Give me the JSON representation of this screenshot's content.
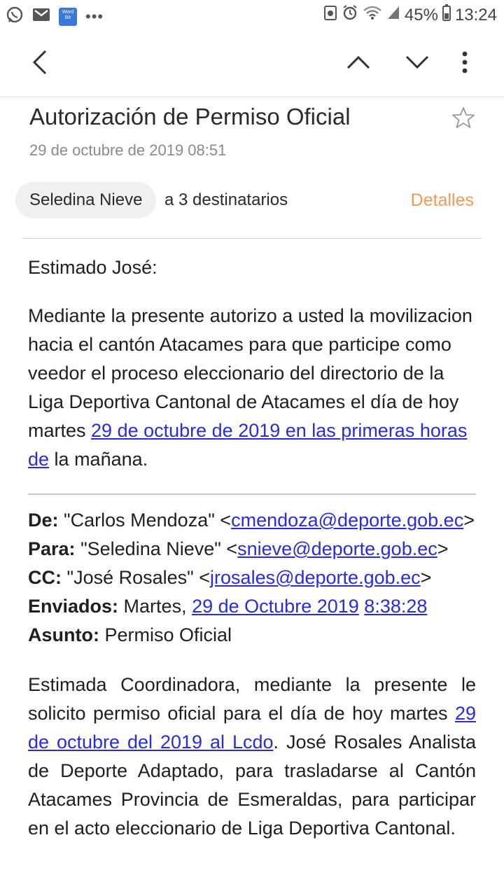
{
  "status": {
    "battery": "45%",
    "time": "13:24",
    "overflow": "•••"
  },
  "email": {
    "subject": "Autorización de Permiso Oficial",
    "date": "29 de octubre de 2019  08:51",
    "sender_chip": "Seledina Nieve",
    "recipients": "a 3 destinatarios",
    "details_label": "Detalles",
    "greeting": "Estimado José:",
    "p1_text": "Mediante la presente autorizo a usted la movilizacion hacia el cantón Atacames para que participe como veedor el proceso eleccionario del directorio de la Liga Deportiva Cantonal de Atacames el día de hoy martes ",
    "p1_link": "29 de octubre de 2019 en las primeras horas de",
    "p1_tail": " la mañana.",
    "fwd": {
      "from_label": "De:",
      "from_name": "\"Carlos Mendoza\"",
      "from_email": "cmendoza@deporte.gob.ec",
      "to_label": "Para:",
      "to_name": "\"Seledina Nieve\"",
      "to_email": "snieve@deporte.gob.ec",
      "cc_label": "CC:",
      "cc_name": "\"José Rosales\"",
      "cc_email": "jrosales@deporte.gob.ec",
      "sent_label": "Enviados:",
      "sent_day": "Martes,",
      "sent_date": "29 de Octubre 2019",
      "sent_time": "8:38:28",
      "subject_label": "Asunto:",
      "subject_value": "Permiso Oficial"
    },
    "p2_text": "Estimada Coordinadora, mediante la presente le solicito permiso oficial para el día de hoy martes ",
    "p2_link": "29 de octubre del 2019 al Lcdo",
    "p2_tail": ". José Rosales Analista de Deporte Adaptado, para trasladarse al Cantón Atacames Provincia de Esmeraldas, para participar en el acto eleccionario de Liga Deportiva Cantonal."
  }
}
